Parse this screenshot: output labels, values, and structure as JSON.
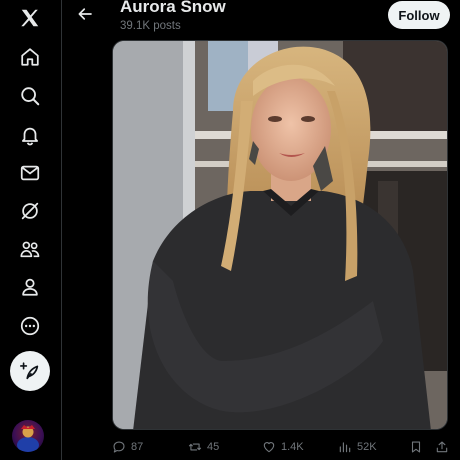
{
  "nav": {
    "logo_icon": "x-logo-icon",
    "items": [
      {
        "name": "home",
        "icon": "home-icon"
      },
      {
        "name": "explore",
        "icon": "search-icon"
      },
      {
        "name": "notifications",
        "icon": "bell-icon"
      },
      {
        "name": "messages",
        "icon": "envelope-icon"
      },
      {
        "name": "grok",
        "icon": "grok-icon"
      },
      {
        "name": "communities",
        "icon": "people-icon"
      },
      {
        "name": "profile",
        "icon": "person-icon"
      },
      {
        "name": "more",
        "icon": "more-circle-icon"
      }
    ],
    "compose_icon": "feather-plus-icon"
  },
  "header": {
    "name": "Aurora Snow",
    "posts": "39.1K posts",
    "follow_label": "Follow"
  },
  "post": {
    "media_description_icon": "photo",
    "actions": {
      "replies": "87",
      "reposts": "45",
      "likes": "1.4K",
      "views": "52K"
    }
  },
  "colors": {
    "background": "#000000",
    "text_primary": "#e7e9ea",
    "text_secondary": "#71767b",
    "follow_bg": "#eff3f4",
    "border": "#2f3336"
  }
}
